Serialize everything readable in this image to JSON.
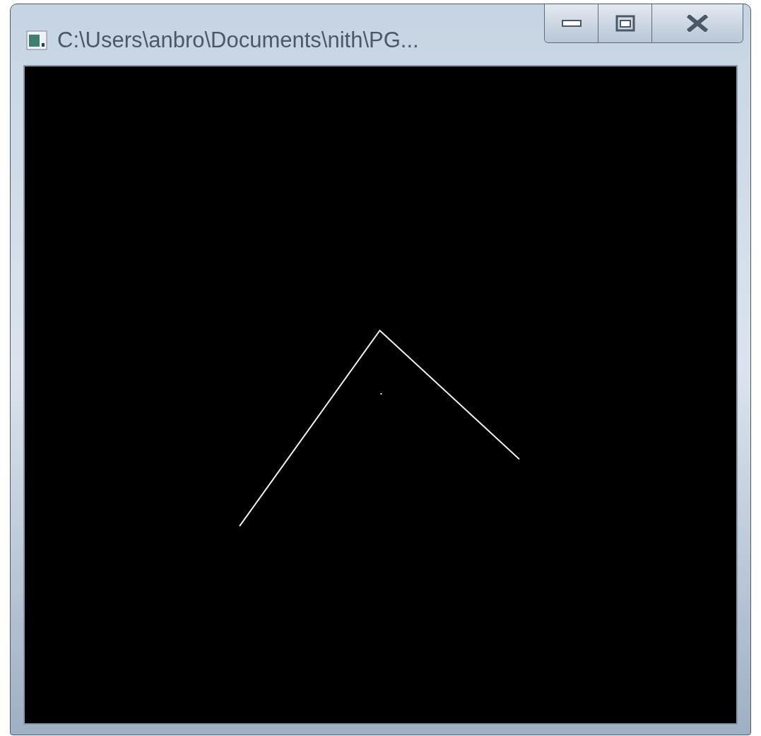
{
  "window": {
    "title": "C:\\Users\\anbro\\Documents\\nith\\PG..."
  }
}
